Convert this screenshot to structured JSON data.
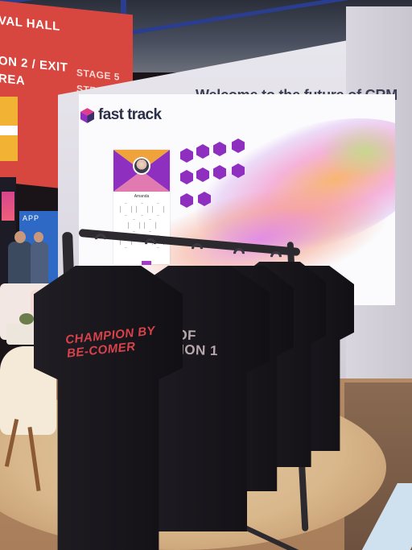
{
  "hall_sign": {
    "line1": "VAL HALL",
    "line2": "ON 2 / EXIT",
    "line3": "REA",
    "stage": "STAGE 5",
    "stage2": "STR"
  },
  "booth": {
    "headline": "Welcome to the future of CRM",
    "logo_text": "fast track",
    "side_booth_label": "APP"
  },
  "screen": {
    "profile_name": "Amanda"
  },
  "shirts": {
    "print_left": "CHAMPION BY\nBE-COMER",
    "print_middle": "E OF\nATION 1"
  },
  "colors": {
    "brand_purple": "#8e2fc0",
    "hall_red": "#d7473f",
    "headline_navy": "#3b3f55",
    "shirt_black": "#17151b"
  }
}
